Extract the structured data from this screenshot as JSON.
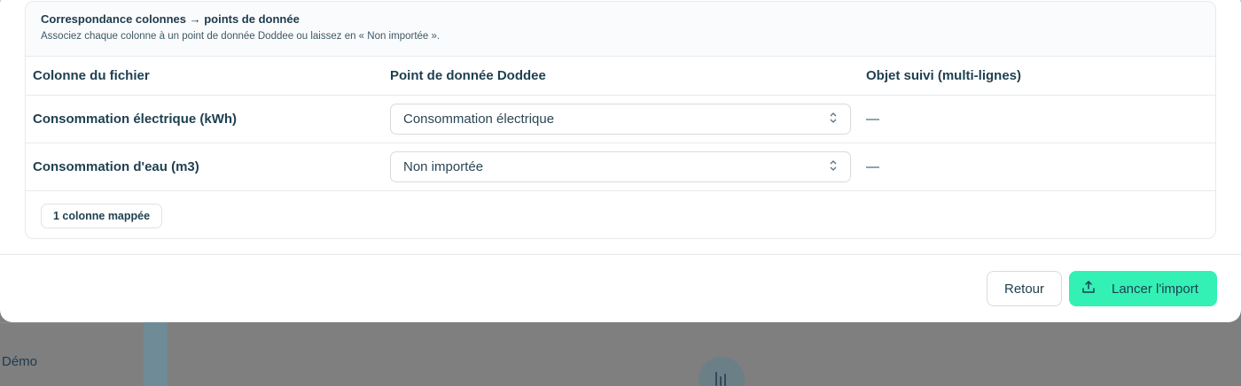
{
  "mapping": {
    "title": "Correspondance colonnes → points de donnée",
    "subtitle": "Associez chaque colonne à un point de donnée Doddee ou laissez en « Non importée ».",
    "columns": [
      "Colonne du fichier",
      "Point de donnée Doddee",
      "Objet suivi (multi-lignes)"
    ],
    "rows": [
      {
        "file_column": "Consommation électrique (kWh)",
        "data_point": "Consommation électrique",
        "tracked_object": "—"
      },
      {
        "file_column": "Consommation d'eau (m3)",
        "data_point": "Non importée",
        "tracked_object": "—"
      }
    ],
    "mapped_badge": "1 colonne mappée"
  },
  "footer": {
    "back_label": "Retour",
    "import_label": "Lancer l'import"
  },
  "background": {
    "sidebar_label": "Démo"
  },
  "icons": {
    "select": "chevron-up-down-icon",
    "import": "upload-icon",
    "chart": "bar-chart-icon"
  },
  "colors": {
    "accent": "#33f0b4",
    "text": "#1e3f50"
  }
}
